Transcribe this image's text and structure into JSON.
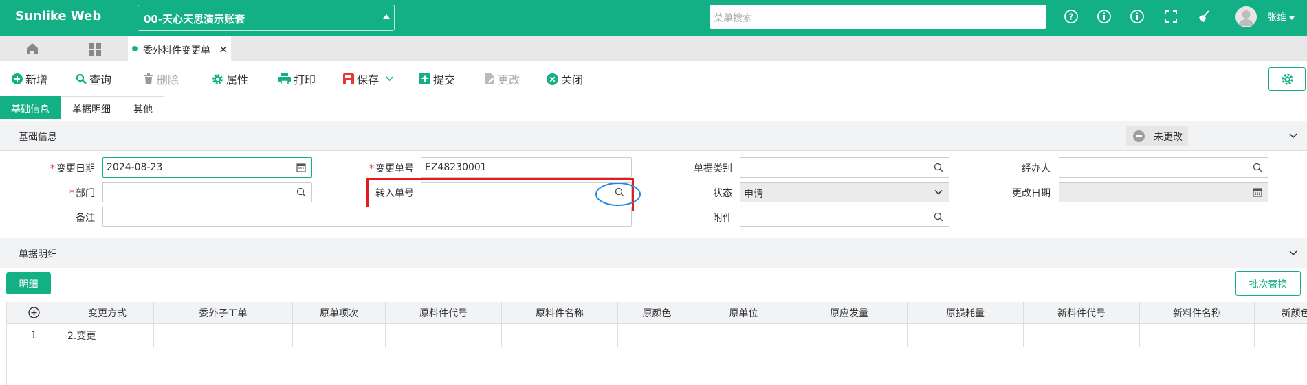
{
  "app": {
    "brand": "Sunlike Web",
    "account": "00-天心天思演示账套",
    "menu_search_placeholder": "菜单搜索",
    "user_name": "张维",
    "colors": {
      "primary": "#14b085",
      "danger": "#e51c1c",
      "highlight": "#1e88e5"
    }
  },
  "header_icons": [
    "help-icon",
    "info-icon",
    "info-icon-2",
    "fullscreen-icon",
    "broom-icon"
  ],
  "tabs": {
    "doc_tab_label": "委外料件变更单"
  },
  "toolbar": {
    "new": "新增",
    "query": "查询",
    "delete": "删除",
    "attr": "属性",
    "print": "打印",
    "save": "保存",
    "submit": "提交",
    "modify": "更改",
    "close": "关闭"
  },
  "section_tabs": [
    "基础信息",
    "单据明细",
    "其他"
  ],
  "basic": {
    "title": "基础信息",
    "status_badge": "未更改",
    "fields": {
      "change_date_label": "变更日期",
      "change_date_value": "2024-08-23",
      "change_no_label": "变更单号",
      "change_no_value": "EZ48230001",
      "doc_type_label": "单据类别",
      "handler_label": "经办人",
      "dept_label": "部门",
      "transfer_no_label": "转入单号",
      "status_label": "状态",
      "status_value": "申请",
      "modify_date_label": "更改日期",
      "remark_label": "备注",
      "attachment_label": "附件"
    },
    "required_mark": "*"
  },
  "detail": {
    "title": "单据明细",
    "detail_btn": "明细",
    "batch_replace_btn": "批次替换",
    "columns": [
      "变更方式",
      "委外子工单",
      "原单项次",
      "原料件代号",
      "原料件名称",
      "原颜色",
      "原单位",
      "原应发量",
      "原损耗量",
      "新料件代号",
      "新料件名称",
      "新颜色"
    ],
    "rows": [
      {
        "no": "1",
        "cells": [
          "2.变更",
          "",
          "",
          "",
          "",
          "",
          "",
          "",
          "",
          "",
          "",
          ""
        ]
      }
    ]
  }
}
